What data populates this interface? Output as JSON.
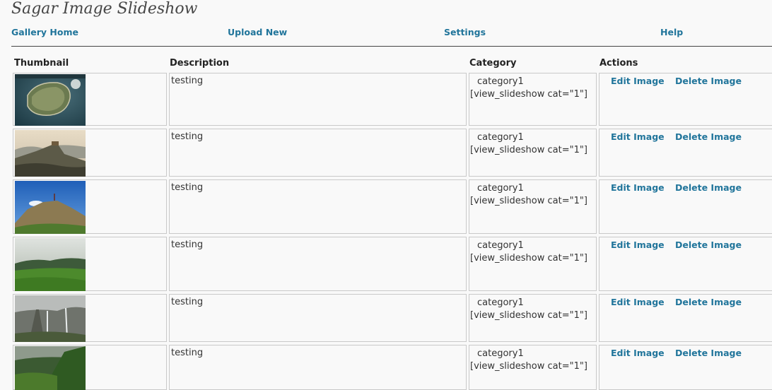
{
  "page_title": "Sagar Image Slideshow",
  "nav": {
    "gallery_home": "Gallery Home",
    "upload_new": "Upload New",
    "settings": "Settings",
    "help": "Help"
  },
  "table": {
    "headers": {
      "thumbnail": "Thumbnail",
      "description": "Description",
      "category": "Category",
      "actions": "Actions"
    },
    "rows": [
      {
        "description": "testing",
        "category": "category1",
        "shortcode": "[view_slideshow cat=\"1\"]",
        "edit": "Edit Image",
        "delete": "Delete Image",
        "thumbnail": "aerial-island-fort"
      },
      {
        "description": "testing",
        "category": "category1",
        "shortcode": "[view_slideshow cat=\"1\"]",
        "edit": "Edit Image",
        "delete": "Delete Image",
        "thumbnail": "hazy-mountain-ridge"
      },
      {
        "description": "testing",
        "category": "category1",
        "shortcode": "[view_slideshow cat=\"1\"]",
        "edit": "Edit Image",
        "delete": "Delete Image",
        "thumbnail": "hilltop-blue-sky"
      },
      {
        "description": "testing",
        "category": "category1",
        "shortcode": "[view_slideshow cat=\"1\"]",
        "edit": "Edit Image",
        "delete": "Delete Image",
        "thumbnail": "green-valley-mist"
      },
      {
        "description": "testing",
        "category": "category1",
        "shortcode": "[view_slideshow cat=\"1\"]",
        "edit": "Edit Image",
        "delete": "Delete Image",
        "thumbnail": "waterfall-cliff"
      },
      {
        "description": "testing",
        "category": "category1",
        "shortcode": "[view_slideshow cat=\"1\"]",
        "edit": "Edit Image",
        "delete": "Delete Image",
        "thumbnail": "green-slope-clouds"
      }
    ]
  },
  "colors": {
    "link": "#21759b",
    "border": "#c9c9c9",
    "background": "#f9f9f9"
  }
}
